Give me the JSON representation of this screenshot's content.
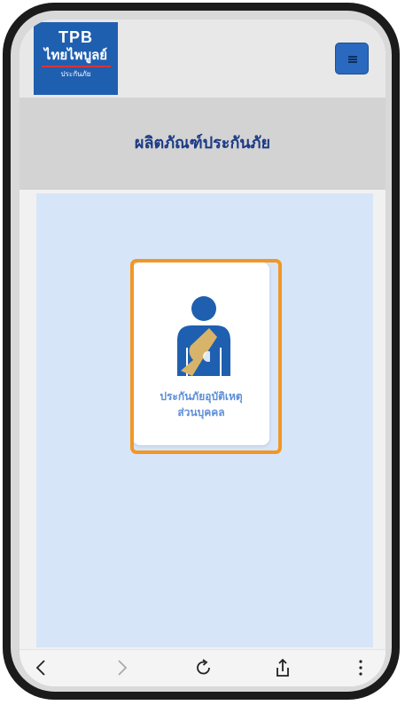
{
  "header": {
    "logo_brand": "TPB",
    "logo_name": "ไทยไพบูลย์",
    "logo_sub": "ประกันภัย",
    "menu_icon": "hamburger-menu-icon"
  },
  "page": {
    "title": "ผลิตภัณฑ์ประกันภัย"
  },
  "products": [
    {
      "icon": "person-arm-sling-icon",
      "label_line1": "ประกันภัยอุบัติเหตุ",
      "label_line2": "ส่วนบุคคล"
    }
  ],
  "browser_toolbar": {
    "items": [
      "back-icon",
      "forward-icon",
      "reload-icon",
      "share-icon",
      "more-icon"
    ]
  },
  "colors": {
    "brand_blue": "#1f5fb0",
    "title_text": "#1c3a84",
    "content_bg": "#d7e5f9",
    "product_label": "#5d8fd6",
    "highlight": "#f29725",
    "sling": "#d8b46a"
  }
}
